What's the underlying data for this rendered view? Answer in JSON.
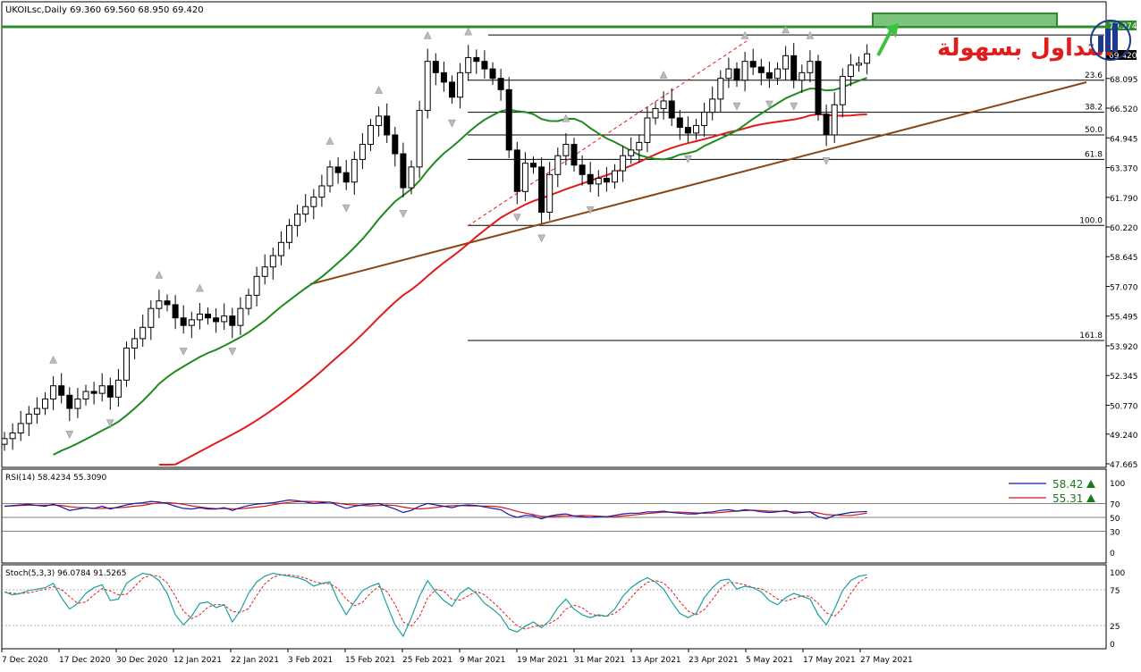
{
  "main_panel": {
    "header": "UKOILsc,Daily  69.360 69.560 68.950 69.420",
    "price_ticks": [
      "70.974",
      "70.420",
      "68.095",
      "66.520",
      "64.945",
      "63.370",
      "61.790",
      "60.220",
      "58.645",
      "57.070",
      "55.495",
      "53.920",
      "52.345",
      "50.770",
      "49.240",
      "47.665"
    ],
    "current_price_label": "70.974",
    "last_price_label": "69.420",
    "fib_levels": [
      {
        "label": "23.6",
        "price": 68.0
      },
      {
        "label": "38.2",
        "price": 66.3
      },
      {
        "label": "50.0",
        "price": 65.1
      },
      {
        "label": "61.8",
        "price": 63.8
      },
      {
        "label": "100.0",
        "price": 60.3
      },
      {
        "label": "161.8",
        "price": 54.2
      }
    ],
    "logo_text": "التداول بسهولة"
  },
  "rsi_panel": {
    "header": "RSI(14) 58.4234 55.3090",
    "ticks": [
      "100",
      "70",
      "50",
      "30",
      "0"
    ],
    "legend": [
      {
        "value": "58.42",
        "color": "#1a1aa6"
      },
      {
        "value": "55.31",
        "color": "#d11a1a"
      }
    ]
  },
  "stoch_panel": {
    "header": "Stoch(5,3,3) 96.0784 91.5265",
    "ticks": [
      "100",
      "75",
      "25",
      "0"
    ]
  },
  "date_labels": [
    "7 Dec 2020",
    "17 Dec 2020",
    "30 Dec 2020",
    "12 Jan 2021",
    "22 Jan 2021",
    "3 Feb 2021",
    "15 Feb 2021",
    "25 Feb 2021",
    "9 Mar 2021",
    "19 Mar 2021",
    "31 Mar 2021",
    "13 Apr 2021",
    "23 Apr 2021",
    "5 May 2021",
    "17 May 2021",
    "27 May 2021"
  ],
  "colors": {
    "ma_fast": "#1f8a1f",
    "ma_slow": "#e31b1b",
    "trendline": "#8b4513",
    "resistance": "#2e8b2e",
    "target_box": "#7cc47c",
    "arrow": "#3cc23c",
    "rsi_line": "#1a1aa6",
    "rsi_signal": "#d11a1a",
    "stoch_main": "#1aa0a0",
    "stoch_signal": "#e31b1b"
  },
  "chart_data": [
    {
      "type": "candlestick",
      "title": "UKOILsc,Daily",
      "ylim": [
        47.665,
        70.974
      ],
      "close_approx": [
        49.0,
        49.3,
        49.8,
        50.3,
        50.6,
        51.1,
        51.8,
        51.3,
        50.6,
        51.1,
        51.5,
        51.4,
        51.8,
        51.2,
        52.1,
        53.8,
        54.3,
        54.9,
        55.9,
        56.3,
        56.1,
        55.4,
        55.0,
        55.3,
        55.6,
        55.4,
        55.2,
        55.5,
        55.0,
        55.9,
        56.6,
        57.6,
        58.1,
        58.7,
        59.4,
        60.3,
        60.9,
        61.3,
        61.8,
        62.4,
        63.4,
        63.1,
        62.6,
        63.8,
        64.6,
        65.6,
        66.1,
        65.1,
        64.1,
        62.3,
        63.4,
        66.4,
        69.0,
        68.4,
        67.9,
        67.1,
        68.4,
        69.2,
        69.0,
        68.6,
        68.1,
        67.5,
        64.3,
        62.1,
        63.6,
        63.4,
        61.0,
        63.0,
        64.0,
        64.6,
        63.5,
        63.0,
        62.5,
        62.8,
        62.6,
        63.2,
        64.0,
        64.3,
        64.7,
        66.0,
        66.5,
        66.9,
        66.0,
        65.5,
        65.2,
        65.6,
        66.3,
        67.0,
        68.1,
        68.6,
        68.0,
        69.0,
        68.7,
        68.4,
        68.1,
        68.6,
        69.3,
        68.0,
        68.4,
        69.0,
        66.2,
        65.1,
        66.7,
        68.2,
        68.8,
        68.9,
        69.4
      ]
    },
    {
      "type": "line",
      "title": "RSI(14)",
      "ylim": [
        0,
        100
      ],
      "series": [
        {
          "name": "RSI(14)",
          "values": [
            66,
            67,
            68,
            69,
            67,
            66,
            69,
            65,
            60,
            62,
            64,
            63,
            66,
            62,
            65,
            68,
            70,
            71,
            73,
            72,
            70,
            66,
            63,
            62,
            64,
            62,
            62,
            64,
            60,
            64,
            67,
            69,
            70,
            71,
            73,
            75,
            74,
            72,
            70,
            71,
            72,
            67,
            63,
            66,
            68,
            69,
            70,
            66,
            62,
            57,
            60,
            66,
            70,
            68,
            66,
            64,
            67,
            68,
            67,
            65,
            63,
            61,
            54,
            50,
            53,
            52,
            48,
            52,
            54,
            55,
            52,
            51,
            50,
            51,
            51,
            53,
            55,
            56,
            56,
            58,
            58,
            59,
            57,
            56,
            55,
            55,
            57,
            58,
            60,
            61,
            59,
            61,
            60,
            58,
            57,
            58,
            60,
            56,
            57,
            58,
            51,
            48,
            53,
            55,
            57,
            58,
            58.4
          ]
        }
      ]
    },
    {
      "type": "line",
      "title": "Stoch(5,3,3)",
      "ylim": [
        0,
        100
      ],
      "series": [
        {
          "name": "Stoch(5,3,3)",
          "values": [
            72,
            68,
            70,
            74,
            76,
            78,
            84,
            64,
            48,
            56,
            70,
            78,
            82,
            60,
            62,
            84,
            92,
            98,
            96,
            88,
            70,
            40,
            26,
            38,
            56,
            58,
            50,
            54,
            30,
            46,
            70,
            86,
            94,
            98,
            96,
            94,
            92,
            88,
            80,
            84,
            86,
            60,
            40,
            58,
            74,
            80,
            84,
            54,
            26,
            10,
            36,
            66,
            88,
            72,
            60,
            52,
            70,
            78,
            70,
            56,
            48,
            38,
            20,
            16,
            24,
            30,
            22,
            32,
            50,
            62,
            48,
            40,
            36,
            40,
            38,
            48,
            66,
            78,
            86,
            92,
            86,
            76,
            58,
            42,
            36,
            42,
            64,
            78,
            88,
            90,
            76,
            80,
            78,
            72,
            60,
            54,
            64,
            70,
            66,
            62,
            40,
            26,
            48,
            74,
            88,
            94,
            96
          ]
        }
      ]
    }
  ]
}
